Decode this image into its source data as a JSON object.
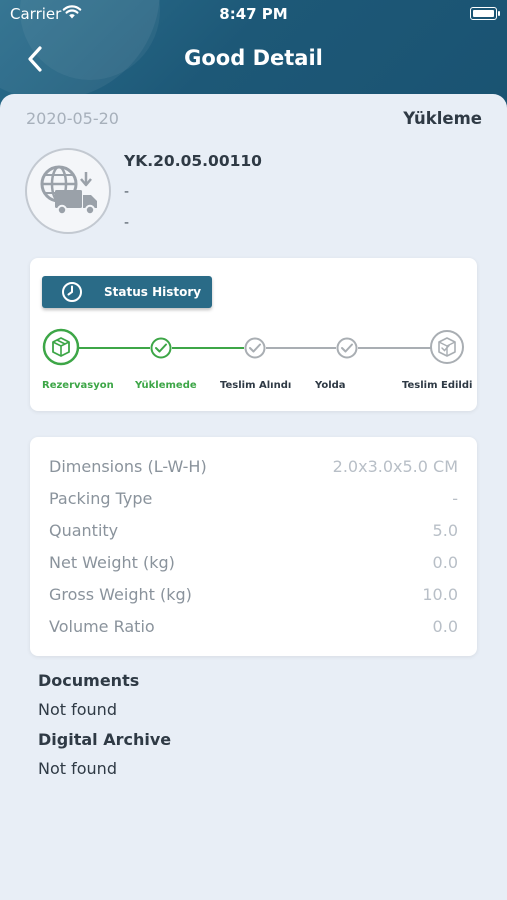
{
  "status_bar": {
    "carrier": "Carrier",
    "time": "8:47 PM"
  },
  "nav": {
    "title": "Good Detail",
    "back_icon": "chevron-left-icon"
  },
  "good": {
    "date": "2020-05-20",
    "status_type": "Yükleme",
    "code": "YK.20.05.00110",
    "line2": "-",
    "line3": "-"
  },
  "status_history": {
    "button_label": "Status History",
    "active_color": "#3da647",
    "inactive_color": "#a9aeb3",
    "steps": [
      {
        "label": "Rezervasyon",
        "state": "done"
      },
      {
        "label": "Yüklemede",
        "state": "done"
      },
      {
        "label": "Teslim Alındı",
        "state": "pending"
      },
      {
        "label": "Yolda",
        "state": "pending"
      },
      {
        "label": "Teslim Edildi",
        "state": "pending"
      }
    ]
  },
  "details": [
    {
      "label": "Dimensions (L-W-H)",
      "value": "2.0x3.0x5.0 CM"
    },
    {
      "label": "Packing Type",
      "value": "-"
    },
    {
      "label": "Quantity",
      "value": "5.0"
    },
    {
      "label": "Net Weight (kg)",
      "value": "0.0"
    },
    {
      "label": "Gross Weight (kg)",
      "value": "10.0"
    },
    {
      "label": "Volume Ratio",
      "value": "0.0"
    }
  ],
  "documents": {
    "title": "Documents",
    "value": "Not found"
  },
  "digital_archive": {
    "title": "Digital Archive",
    "value": "Not found"
  }
}
